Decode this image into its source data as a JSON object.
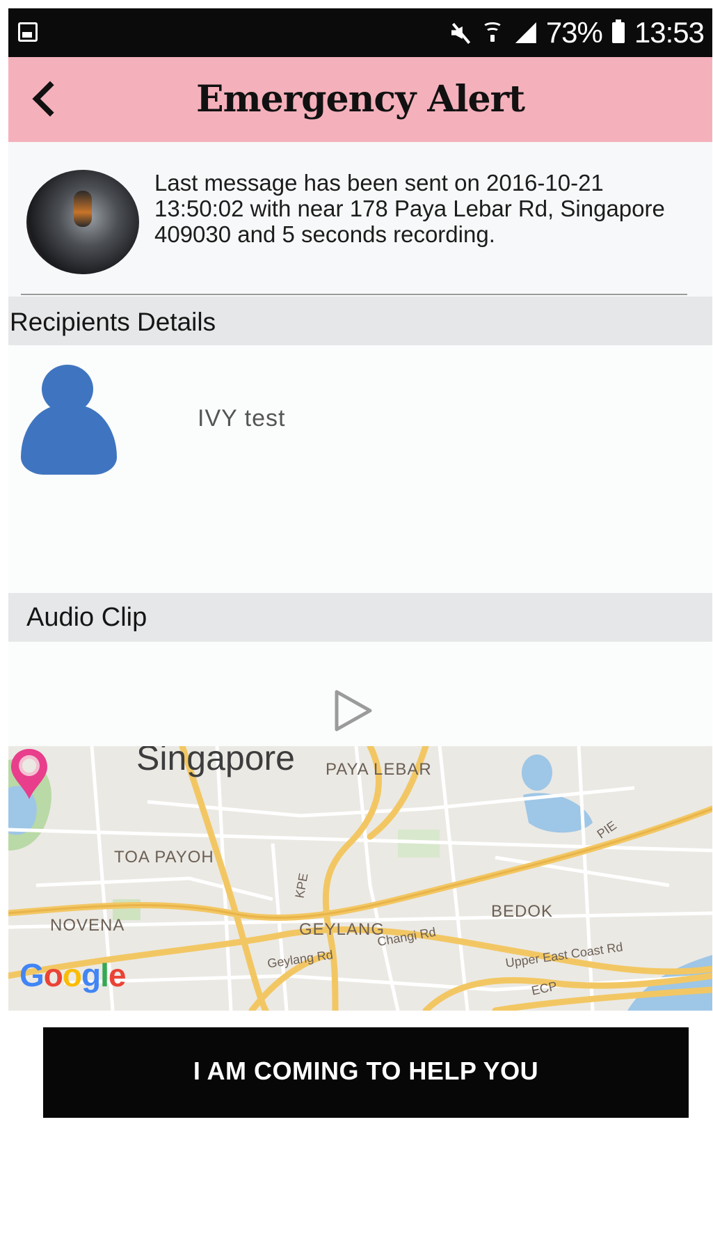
{
  "status_bar": {
    "battery": "73%",
    "time": "13:53",
    "icons": [
      "gallery-icon",
      "mute-icon",
      "wifi-icon",
      "signal-icon",
      "battery-icon"
    ]
  },
  "header": {
    "title": "Emergency Alert",
    "background": "#f4b1bb"
  },
  "message": {
    "text": "Last message has been sent on 2016-10-21 13:50:02 with near 178 Paya Lebar Rd, Singapore 409030 and 5 seconds recording."
  },
  "recipients": {
    "heading": "Recipients Details",
    "items": [
      {
        "name": "IVY test"
      }
    ]
  },
  "audio": {
    "heading": "Audio Clip"
  },
  "map": {
    "labels": {
      "city": "Singapore",
      "paya_lebar": "PAYA LEBAR",
      "toa_payoh": "TOA PAYOH",
      "novena": "NOVENA",
      "geylang": "GEYLANG",
      "bedok": "BEDOK",
      "kpe": "KPE",
      "pie": "PIE",
      "ecp": "ECP",
      "geylang_rd": "Geylang Rd",
      "changi_rd": "Changi Rd",
      "upper_east_coast_rd": "Upper East Coast Rd"
    },
    "pin_color": "#e83e8c",
    "attribution": "Google"
  },
  "action": {
    "help_label": "I AM COMING TO HELP YOU"
  }
}
